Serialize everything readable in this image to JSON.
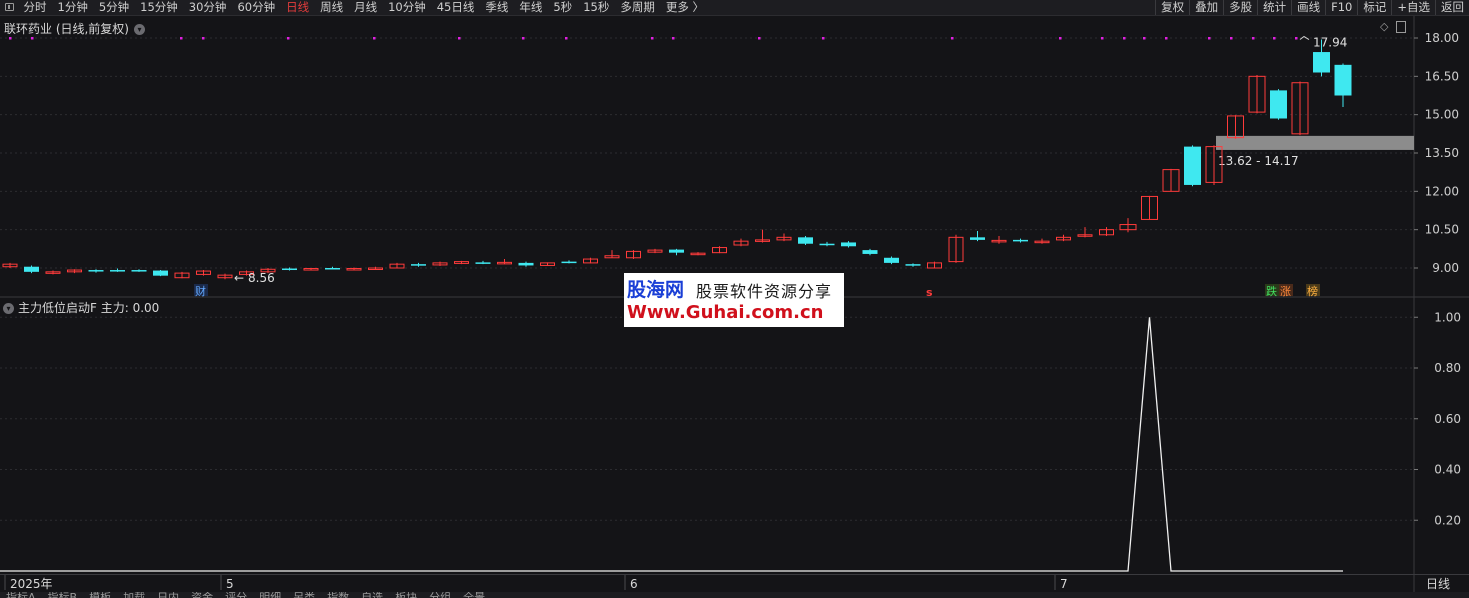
{
  "toolbar": {
    "periods": [
      "分时",
      "1分钟",
      "5分钟",
      "15分钟",
      "30分钟",
      "60分钟",
      "日线",
      "周线",
      "月线",
      "10分钟",
      "45日线",
      "季线",
      "年线",
      "5秒",
      "15秒",
      "多周期",
      "更多 〉"
    ],
    "active_period": "日线",
    "right_tools": [
      "复权",
      "叠加",
      "多股",
      "统计",
      "画线",
      "F10",
      "标记",
      "+自选",
      "返回"
    ]
  },
  "main_chart": {
    "title": "联环药业 (日线,前复权)",
    "price_axis": [
      "18.00",
      "16.50",
      "15.00",
      "13.50",
      "12.00",
      "10.50",
      "9.00"
    ],
    "high_label": "17.94",
    "low_label": "8.56",
    "zone_label": "13.62 - 14.17",
    "marker_cai": "财",
    "marker_s": "s",
    "marker_die": "跌",
    "marker_zhang": "涨",
    "marker_bang": "榜"
  },
  "indicator": {
    "title": "主力低位启动F  主力: 0.00",
    "axis": [
      "1.00",
      "0.80",
      "0.60",
      "0.40",
      "0.20"
    ]
  },
  "time_axis": {
    "labels": [
      "2025年",
      "5",
      "6",
      "7"
    ],
    "period_label": "日线"
  },
  "watermark": {
    "line1": "股海网",
    "line2": "股票软件资源分享",
    "line3": "Www.Guhai.com.cn"
  },
  "bottom_tabs": [
    "指标A",
    "指标B",
    "模板",
    "加载",
    "日内",
    "资金",
    "评分",
    "明细",
    "另类",
    "指数",
    "自选",
    "板块",
    "分组",
    "全景"
  ],
  "chart_data": {
    "type": "candlestick",
    "title": "联环药业 (日线,前复权)",
    "ylim": [
      8.0,
      18.6
    ],
    "candles": [
      {
        "o": 9.05,
        "c": 9.15,
        "h": 9.2,
        "l": 9.0
      },
      {
        "o": 9.05,
        "c": 8.85,
        "h": 9.1,
        "l": 8.8
      },
      {
        "o": 8.8,
        "c": 8.85,
        "h": 8.9,
        "l": 8.75
      },
      {
        "o": 8.85,
        "c": 8.92,
        "h": 8.95,
        "l": 8.8
      },
      {
        "o": 8.92,
        "c": 8.88,
        "h": 8.95,
        "l": 8.82
      },
      {
        "o": 8.92,
        "c": 8.88,
        "h": 8.98,
        "l": 8.85
      },
      {
        "o": 8.92,
        "c": 8.88,
        "h": 8.95,
        "l": 8.85
      },
      {
        "o": 8.9,
        "c": 8.7,
        "h": 8.92,
        "l": 8.68
      },
      {
        "o": 8.62,
        "c": 8.8,
        "h": 8.85,
        "l": 8.6
      },
      {
        "o": 8.75,
        "c": 8.88,
        "h": 8.92,
        "l": 8.7
      },
      {
        "o": 8.62,
        "c": 8.72,
        "h": 8.78,
        "l": 8.56
      },
      {
        "o": 8.75,
        "c": 8.85,
        "h": 8.9,
        "l": 8.7
      },
      {
        "o": 8.85,
        "c": 8.95,
        "h": 9.0,
        "l": 8.8
      },
      {
        "o": 8.98,
        "c": 8.95,
        "h": 9.02,
        "l": 8.9
      },
      {
        "o": 8.92,
        "c": 8.98,
        "h": 9.0,
        "l": 8.9
      },
      {
        "o": 9.0,
        "c": 8.98,
        "h": 9.05,
        "l": 8.95
      },
      {
        "o": 8.95,
        "c": 8.98,
        "h": 9.02,
        "l": 8.92
      },
      {
        "o": 8.95,
        "c": 9.0,
        "h": 9.05,
        "l": 8.92
      },
      {
        "o": 9.0,
        "c": 9.15,
        "h": 9.2,
        "l": 8.98
      },
      {
        "o": 9.15,
        "c": 9.12,
        "h": 9.2,
        "l": 9.05
      },
      {
        "o": 9.12,
        "c": 9.2,
        "h": 9.25,
        "l": 9.08
      },
      {
        "o": 9.18,
        "c": 9.25,
        "h": 9.28,
        "l": 9.15
      },
      {
        "o": 9.22,
        "c": 9.2,
        "h": 9.28,
        "l": 9.15
      },
      {
        "o": 9.18,
        "c": 9.22,
        "h": 9.35,
        "l": 9.15
      },
      {
        "o": 9.2,
        "c": 9.1,
        "h": 9.25,
        "l": 9.05
      },
      {
        "o": 9.1,
        "c": 9.2,
        "h": 9.22,
        "l": 9.08
      },
      {
        "o": 9.25,
        "c": 9.2,
        "h": 9.3,
        "l": 9.18
      },
      {
        "o": 9.2,
        "c": 9.35,
        "h": 9.4,
        "l": 9.18
      },
      {
        "o": 9.4,
        "c": 9.48,
        "h": 9.7,
        "l": 9.4
      },
      {
        "o": 9.4,
        "c": 9.65,
        "h": 9.7,
        "l": 9.35
      },
      {
        "o": 9.62,
        "c": 9.7,
        "h": 9.75,
        "l": 9.58
      },
      {
        "o": 9.72,
        "c": 9.6,
        "h": 9.75,
        "l": 9.5
      },
      {
        "o": 9.55,
        "c": 9.58,
        "h": 9.62,
        "l": 9.5
      },
      {
        "o": 9.6,
        "c": 9.8,
        "h": 9.85,
        "l": 9.58
      },
      {
        "o": 9.9,
        "c": 10.05,
        "h": 10.15,
        "l": 9.85
      },
      {
        "o": 10.05,
        "c": 10.1,
        "h": 10.5,
        "l": 10.0
      },
      {
        "o": 10.1,
        "c": 10.2,
        "h": 10.35,
        "l": 10.05
      },
      {
        "o": 10.2,
        "c": 9.95,
        "h": 10.25,
        "l": 9.9
      },
      {
        "o": 9.95,
        "c": 9.9,
        "h": 10.02,
        "l": 9.85
      },
      {
        "o": 10.0,
        "c": 9.85,
        "h": 10.05,
        "l": 9.8
      },
      {
        "o": 9.7,
        "c": 9.55,
        "h": 9.75,
        "l": 9.5
      },
      {
        "o": 9.4,
        "c": 9.2,
        "h": 9.45,
        "l": 9.15
      },
      {
        "o": 9.15,
        "c": 9.1,
        "h": 9.18,
        "l": 9.05
      },
      {
        "o": 9.0,
        "c": 9.2,
        "h": 9.25,
        "l": 9.0
      },
      {
        "o": 9.25,
        "c": 10.2,
        "h": 10.3,
        "l": 9.2
      },
      {
        "o": 10.2,
        "c": 10.1,
        "h": 10.45,
        "l": 10.05
      },
      {
        "o": 10.05,
        "c": 10.08,
        "h": 10.25,
        "l": 9.95
      },
      {
        "o": 10.1,
        "c": 10.05,
        "h": 10.15,
        "l": 10.0
      },
      {
        "o": 10.0,
        "c": 10.05,
        "h": 10.15,
        "l": 9.95
      },
      {
        "o": 10.1,
        "c": 10.2,
        "h": 10.3,
        "l": 10.05
      },
      {
        "o": 10.25,
        "c": 10.3,
        "h": 10.6,
        "l": 10.2
      },
      {
        "o": 10.3,
        "c": 10.5,
        "h": 10.6,
        "l": 10.25
      },
      {
        "o": 10.5,
        "c": 10.7,
        "h": 10.95,
        "l": 10.4
      },
      {
        "o": 10.9,
        "c": 11.8,
        "h": 11.82,
        "l": 10.9
      },
      {
        "o": 12.0,
        "c": 12.85,
        "h": 12.88,
        "l": 12.0
      },
      {
        "o": 13.75,
        "c": 12.25,
        "h": 13.8,
        "l": 12.2
      },
      {
        "o": 12.35,
        "c": 13.75,
        "h": 13.8,
        "l": 12.25
      },
      {
        "o": 14.1,
        "c": 14.95,
        "h": 14.98,
        "l": 14.05
      },
      {
        "o": 15.1,
        "c": 16.5,
        "h": 16.55,
        "l": 15.05
      },
      {
        "o": 15.95,
        "c": 14.85,
        "h": 16.0,
        "l": 14.8
      },
      {
        "o": 14.25,
        "c": 16.25,
        "h": 16.3,
        "l": 14.2
      },
      {
        "o": 17.45,
        "c": 16.65,
        "h": 17.94,
        "l": 16.5
      },
      {
        "o": 16.95,
        "c": 15.75,
        "h": 17.0,
        "l": 15.3
      }
    ],
    "zone": [
      13.62,
      14.17
    ],
    "indicator_series": {
      "name": "主力",
      "ylim": [
        0,
        1.0
      ],
      "spike_index": 53,
      "spike_value": 1.0
    }
  }
}
